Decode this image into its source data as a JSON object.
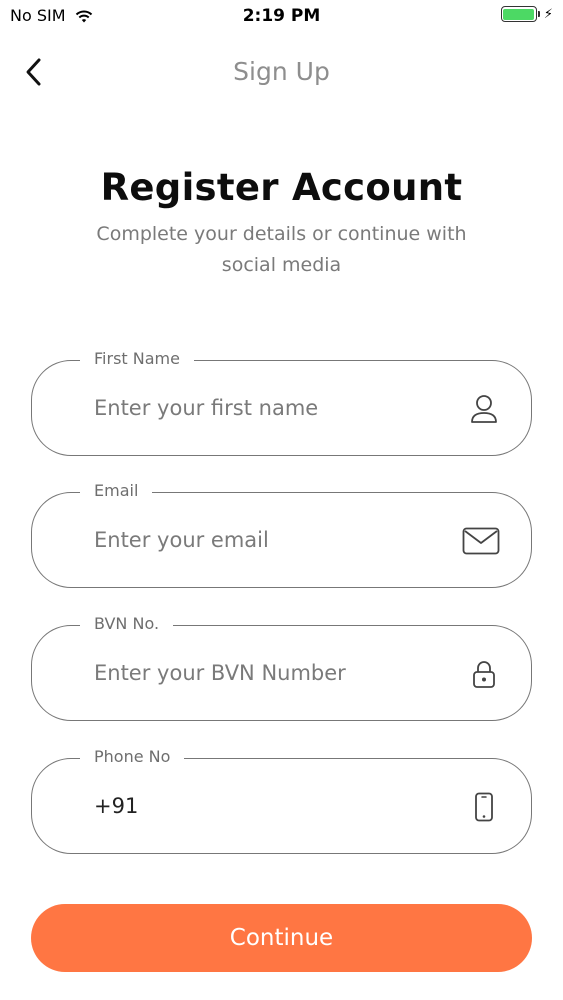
{
  "status_bar": {
    "carrier": "No SIM",
    "time": "2:19 PM",
    "battery_level": 1.0
  },
  "nav": {
    "title": "Sign Up",
    "back_icon": "chevron-left-icon"
  },
  "header": {
    "title": "Register Account",
    "subtitle": "Complete your details or continue with social media"
  },
  "fields": [
    {
      "label": "First Name",
      "placeholder": "Enter your first name",
      "value": "",
      "icon": "user-icon"
    },
    {
      "label": "Email",
      "placeholder": "Enter your email",
      "value": "",
      "icon": "mail-icon"
    },
    {
      "label": "BVN No.",
      "placeholder": "Enter your BVN Number",
      "value": "",
      "icon": "lock-icon"
    },
    {
      "label": "Phone No",
      "placeholder": "",
      "value": "+91",
      "icon": "phone-icon"
    }
  ],
  "continue_button": {
    "label": "Continue",
    "color": "#ff7643"
  },
  "colors": {
    "accent": "#ff7643",
    "border": "#777777",
    "title": "#0d0d0d",
    "muted": "#7a7a7a"
  }
}
